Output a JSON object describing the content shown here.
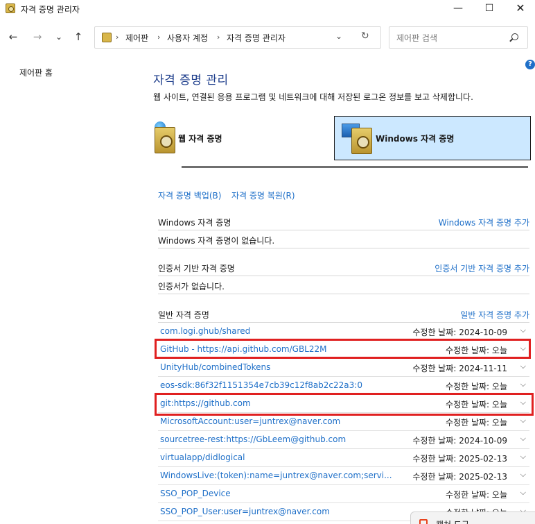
{
  "window": {
    "title": "자격 증명 관리자",
    "minimize_glyph": "—",
    "maximize_glyph": "☐",
    "close_glyph": "✕"
  },
  "nav": {
    "back_glyph": "←",
    "forward_glyph": "→",
    "recent_glyph": "⌄",
    "up_glyph": "↑",
    "breadcrumb": [
      "제어판",
      "사용자 계정",
      "자격 증명 관리자"
    ],
    "breadcrumb_sep": "›",
    "dropdown_glyph": "⌄",
    "refresh_glyph": "↻",
    "search_placeholder": "제어판 검색"
  },
  "sidebar": {
    "home_label": "제어판 홈"
  },
  "help_glyph": "?",
  "header": {
    "title": "자격 증명 관리",
    "description": "웹 사이트, 연결된 응용 프로그램 및 네트워크에 대해 저장된 로그온 정보를 보고 삭제합니다."
  },
  "tabs": {
    "web_label": "웹 자격 증명",
    "windows_label": "Windows 자격 증명",
    "selected": "windows"
  },
  "actions": {
    "backup": "자격 증명 백업(B)",
    "restore": "자격 증명 복원(R)"
  },
  "sections": {
    "windows": {
      "title": "Windows 자격 증명",
      "add": "Windows 자격 증명 추가",
      "empty": "Windows 자격 증명이 없습니다."
    },
    "certificate": {
      "title": "인증서 기반 자격 증명",
      "add": "인증서 기반 자격 증명 추가",
      "empty": "인증서가 없습니다."
    },
    "generic": {
      "title": "일반 자격 증명",
      "add": "일반 자격 증명 추가",
      "items": [
        {
          "name": "com.logi.ghub/shared",
          "date": "수정한 날짜:  2024-10-09"
        },
        {
          "name": "GitHub - https://api.github.com/GBL22M",
          "date": "수정한 날짜:  오늘"
        },
        {
          "name": "UnityHub/combinedTokens",
          "date": "수정한 날짜:  2024-11-11"
        },
        {
          "name": "eos-sdk:86f32f1151354e7cb39c12f8ab2c22a3:0",
          "date": "수정한 날짜:  오늘"
        },
        {
          "name": "git:https://github.com",
          "date": "수정한 날짜:  오늘"
        },
        {
          "name": "MicrosoftAccount:user=juntrex@naver.com",
          "date": "수정한 날짜:  오늘"
        },
        {
          "name": "sourcetree-rest:https://GbLeem@github.com",
          "date": "수정한 날짜:  2024-10-09"
        },
        {
          "name": "virtualapp/didlogical",
          "date": "수정한 날짜:  2025-02-13"
        },
        {
          "name": "WindowsLive:(token):name=juntrex@naver.com;servi...",
          "date": "수정한 날짜:  2025-02-13"
        },
        {
          "name": "SSO_POP_Device",
          "date": "수정한 날짜:  오늘"
        },
        {
          "name": "SSO_POP_User:user=juntrex@naver.com",
          "date": "수정한 날짜:  오늘"
        }
      ],
      "chevron_glyph": "⌵"
    }
  },
  "popup": {
    "label": "캡처 도구"
  },
  "colors": {
    "link": "#1e6fc8",
    "title": "#1e3e8c",
    "selected_tab": "#cce8ff",
    "highlight": "#e02020"
  }
}
